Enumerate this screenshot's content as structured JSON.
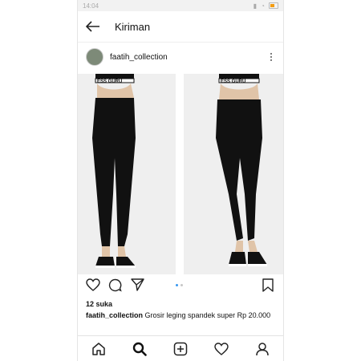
{
  "status_bar": {
    "time": "14:04"
  },
  "header": {
    "title": "Kiriman"
  },
  "post": {
    "username": "faatih_collection",
    "image_text": {
      "left_band": "ESS GURU",
      "right_band": "ESS GURU"
    },
    "likes": "12 suka",
    "caption_user": "faatih_collection",
    "caption_text": "Grosir leging spandek super Rp 20.000",
    "carousel": {
      "count": 2,
      "active": 0,
      "active_color": "#3897f0",
      "inactive_color": "#c7c7c7"
    }
  },
  "icons": {
    "back": "back-arrow-icon",
    "more": "more-options-icon",
    "like": "heart-icon",
    "comment": "comment-icon",
    "share": "send-icon",
    "save": "bookmark-icon",
    "home": "home-icon",
    "search": "search-icon",
    "add": "add-post-icon",
    "activity": "activity-heart-icon",
    "profile": "profile-icon"
  }
}
